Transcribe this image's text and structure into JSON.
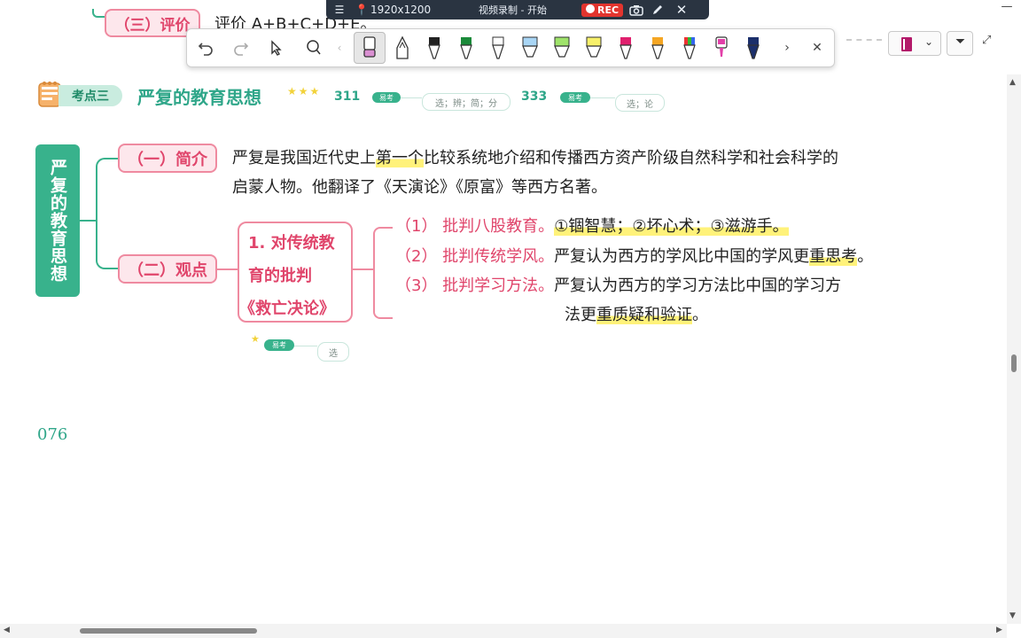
{
  "screen_recorder": {
    "resolution": "1920x1200",
    "status": "视频录制 - 开始",
    "rec_label": "REC"
  },
  "top_fragment": {
    "pill": "（三）评价",
    "text": "评价 A+B+C+D+E。"
  },
  "section": {
    "label": "考点三",
    "title": "严复的教育思想",
    "stars": "★★★",
    "code1": "311",
    "tag1": "易考",
    "tag1_types": "选；辨；简；分",
    "code2": "333",
    "tag2": "易考",
    "tag2_types": "选；论"
  },
  "sidebar_vertical": "严复的教育思想",
  "intro": {
    "pill": "（一）简介",
    "line1_pre": "严复是我国近代史上",
    "line1_hl": "第一个",
    "line1_post": "比较系统地介绍和传播西方资产阶级自然科学和社会科学的",
    "line2": "启蒙人物。他翻译了《天演论》《原富》等西方名著。"
  },
  "views": {
    "pill": "（二）观点",
    "box_line1": "1. 对传统教",
    "box_line2": "育的批判",
    "box_line3": "《救亡决论》",
    "star": "★",
    "tag": "易考",
    "tag_type": "选",
    "items": [
      {
        "head": "（1） 批判八股教育。",
        "body_pre": "",
        "body_hl": "①锢智慧；②坏心术；③滋游手。",
        "body_post": ""
      },
      {
        "head": "（2） 批判传统学风。",
        "body_pre": "严复认为西方的学风比中国的学风更",
        "body_hl": "重思考",
        "body_post": "。"
      },
      {
        "head": "（3） 批判学习方法。",
        "body_pre": "严复认为西方的学习方法比中国的学习方",
        "body_hl": "",
        "body_post": ""
      }
    ],
    "item3_line2_pre": "法更",
    "item3_line2_hl": "重质疑和验证",
    "item3_line2_post": "。"
  },
  "page_number": "076",
  "colors": {
    "teal": "#38b28c",
    "pink": "#e0456b",
    "highlight": "#fff27a",
    "recbar": "#2a3441",
    "rec_red": "#e2342e"
  },
  "pen_toolbar": {
    "tools": [
      "undo-icon",
      "redo-icon",
      "select-icon",
      "lasso-icon",
      "eraser-icon",
      "pen-outline-icon",
      "pen-black-icon",
      "pen-green-icon",
      "pen-white-icon",
      "highlighter-blue-icon",
      "highlighter-green-icon",
      "highlighter-yellow-icon",
      "pen-magenta-icon",
      "pen-orange-icon",
      "pen-rainbow-icon",
      "pen-pink-icon",
      "pen-navy-icon",
      "next-icon",
      "close-icon"
    ]
  }
}
